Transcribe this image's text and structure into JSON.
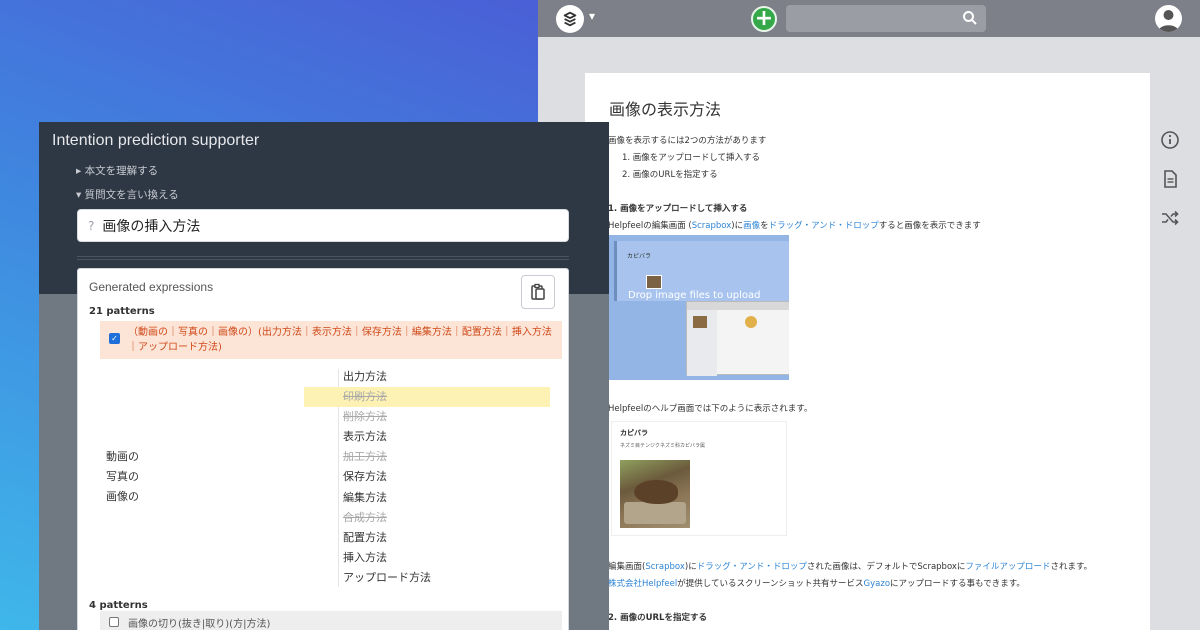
{
  "scrapbox": {
    "page_title": "画像の表示方法",
    "intro": "画像を表示するには2つの方法があります",
    "list": [
      "1. 画像をアップロードして挿入する",
      "2. 画像のURLを指定する"
    ],
    "section1_heading": "1. 画像をアップロードして挿入する",
    "section1_line": {
      "a": "Helpfeelの編集画面 (",
      "link1": "Scrapbox",
      "b": ")に",
      "link2": "画像",
      "c": "を",
      "link3": "ドラッグ・アンド・ドロップ",
      "d": "すると画像を表示できます"
    },
    "shot1": {
      "caption": "カピバラ",
      "drop_text": "Drop image files to upload"
    },
    "help_line": "Helpfeelのヘルプ画面では下のように表示されます。",
    "shot2": {
      "caption": "カピバラ",
      "sub": "ネズミ目テンジクネズミ科カピバラ属"
    },
    "line_a": {
      "a": "編集画面(",
      "link1": "Scrapbox",
      "b": ")に",
      "link2": "ドラッグ・アンド・ドロップ",
      "c": "された画像は、デフォルトでScrapboxに",
      "link3": "ファイルアップロード",
      "d": "されます。"
    },
    "line_b": {
      "link1": "株式会社Helpfeel",
      "a": "が提供しているスクリーンショット共有サービス",
      "link2": "Gyazo",
      "b": "にアップロードする事もできます。"
    },
    "section2_heading": "2. 画像のURLを指定する"
  },
  "ip": {
    "title": "Intention prediction supporter",
    "toggle1": "▸ 本文を理解する",
    "toggle2": "▾ 質問文を言い換える",
    "input_value": "画像の挿入方法",
    "input_prefix": "?",
    "card_title": "Generated expressions",
    "count1": "21 patterns",
    "pattern1": "（動画の｜写真の｜画像の）(出力方法｜表示方法｜保存方法｜編集方法｜配置方法｜挿入方法｜アップロード方法)",
    "left_terms": [
      "動画の",
      "写真の",
      "画像の"
    ],
    "right_terms": [
      {
        "text": "出力方法",
        "state": "normal"
      },
      {
        "text": "印刷方法",
        "state": "struck-hl"
      },
      {
        "text": "削除方法",
        "state": "struck"
      },
      {
        "text": "表示方法",
        "state": "normal"
      },
      {
        "text": "加工方法",
        "state": "struck"
      },
      {
        "text": "保存方法",
        "state": "normal"
      },
      {
        "text": "編集方法",
        "state": "normal"
      },
      {
        "text": "合成方法",
        "state": "struck"
      },
      {
        "text": "配置方法",
        "state": "normal"
      },
      {
        "text": "挿入方法",
        "state": "normal"
      },
      {
        "text": "アップロード方法",
        "state": "normal"
      }
    ],
    "count2": "4 patterns",
    "pattern2": "画像の切り(抜き|取り)(方|方法)"
  },
  "colors": {
    "link": "#2e84d6",
    "pattern_text": "#d04a1a",
    "pattern_bg": "#fce4d6",
    "header_dark": "#2e3744",
    "plus_green": "#35a84a"
  }
}
